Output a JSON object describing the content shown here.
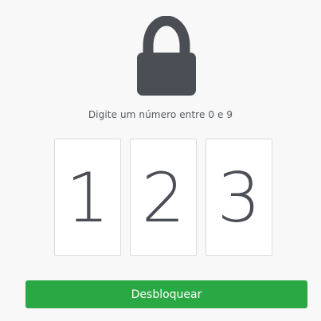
{
  "lock": {
    "icon": "lock-icon",
    "color": "#4b4f55"
  },
  "instruction": "Digite um número entre 0 e 9",
  "digits": [
    "1",
    "2",
    "3"
  ],
  "unlock_button": {
    "label": "Desbloquear",
    "color": "#2aa843"
  }
}
